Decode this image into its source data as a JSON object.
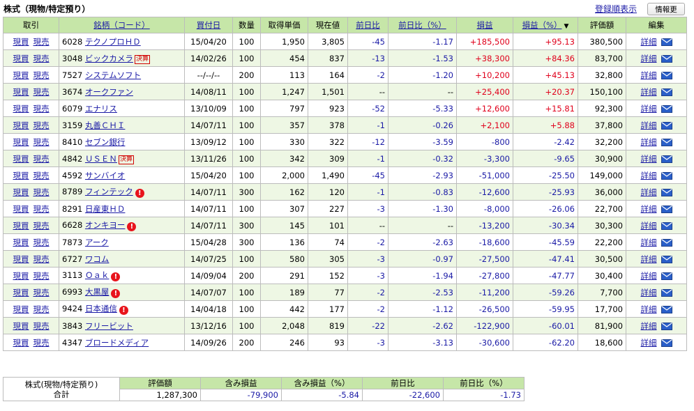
{
  "header": {
    "title": "株式（現物/特定預り）",
    "sort_link": "登録順表示",
    "refresh_button": "情報更新"
  },
  "columns": [
    "取引",
    "銘柄（コード）",
    "買付日",
    "数量",
    "取得単価",
    "現在値",
    "前日比",
    "前日比（%）",
    "損益",
    "損益（%）",
    "評価額",
    "編集"
  ],
  "sort_marker": "▼",
  "actions": {
    "buy": "現買",
    "sell": "現売",
    "detail": "詳細"
  },
  "badges": {
    "kessan": "決算"
  },
  "rows": [
    {
      "code": "6028",
      "name": "テクノプロＨＤ",
      "date": "15/04/20",
      "qty": "100",
      "cost": "1,950",
      "price": "3,805",
      "chg": "-45",
      "chg_pct": "-1.17",
      "pl": "+185,500",
      "pl_pct": "+95.13",
      "value": "380,500",
      "badge": "",
      "alert": false
    },
    {
      "code": "3048",
      "name": "ビックカメラ",
      "date": "14/02/26",
      "qty": "100",
      "cost": "454",
      "price": "837",
      "chg": "-13",
      "chg_pct": "-1.53",
      "pl": "+38,300",
      "pl_pct": "+84.36",
      "value": "83,700",
      "badge": "決算",
      "alert": false
    },
    {
      "code": "7527",
      "name": "システムソフト",
      "date": "--/--/--",
      "qty": "200",
      "cost": "113",
      "price": "164",
      "chg": "-2",
      "chg_pct": "-1.20",
      "pl": "+10,200",
      "pl_pct": "+45.13",
      "value": "32,800",
      "badge": "",
      "alert": false
    },
    {
      "code": "3674",
      "name": "オークファン",
      "date": "14/08/11",
      "qty": "100",
      "cost": "1,247",
      "price": "1,501",
      "chg": "--",
      "chg_pct": "--",
      "pl": "+25,400",
      "pl_pct": "+20.37",
      "value": "150,100",
      "badge": "",
      "alert": false
    },
    {
      "code": "6079",
      "name": "エナリス",
      "date": "13/10/09",
      "qty": "100",
      "cost": "797",
      "price": "923",
      "chg": "-52",
      "chg_pct": "-5.33",
      "pl": "+12,600",
      "pl_pct": "+15.81",
      "value": "92,300",
      "badge": "",
      "alert": false
    },
    {
      "code": "3159",
      "name": "丸善ＣＨＩ",
      "date": "14/07/11",
      "qty": "100",
      "cost": "357",
      "price": "378",
      "chg": "-1",
      "chg_pct": "-0.26",
      "pl": "+2,100",
      "pl_pct": "+5.88",
      "value": "37,800",
      "badge": "",
      "alert": false
    },
    {
      "code": "8410",
      "name": "セブン銀行",
      "date": "13/09/12",
      "qty": "100",
      "cost": "330",
      "price": "322",
      "chg": "-12",
      "chg_pct": "-3.59",
      "pl": "-800",
      "pl_pct": "-2.42",
      "value": "32,200",
      "badge": "",
      "alert": false
    },
    {
      "code": "4842",
      "name": "ＵＳＥＮ",
      "date": "13/11/26",
      "qty": "100",
      "cost": "342",
      "price": "309",
      "chg": "-1",
      "chg_pct": "-0.32",
      "pl": "-3,300",
      "pl_pct": "-9.65",
      "value": "30,900",
      "badge": "決算",
      "alert": false
    },
    {
      "code": "4592",
      "name": "サンバイオ",
      "date": "15/04/20",
      "qty": "100",
      "cost": "2,000",
      "price": "1,490",
      "chg": "-45",
      "chg_pct": "-2.93",
      "pl": "-51,000",
      "pl_pct": "-25.50",
      "value": "149,000",
      "badge": "",
      "alert": false
    },
    {
      "code": "8789",
      "name": "フィンテック",
      "date": "14/07/11",
      "qty": "300",
      "cost": "162",
      "price": "120",
      "chg": "-1",
      "chg_pct": "-0.83",
      "pl": "-12,600",
      "pl_pct": "-25.93",
      "value": "36,000",
      "badge": "",
      "alert": true
    },
    {
      "code": "8291",
      "name": "日産東ＨＤ",
      "date": "14/07/11",
      "qty": "100",
      "cost": "307",
      "price": "227",
      "chg": "-3",
      "chg_pct": "-1.30",
      "pl": "-8,000",
      "pl_pct": "-26.06",
      "value": "22,700",
      "badge": "",
      "alert": false
    },
    {
      "code": "6628",
      "name": "オンキヨー",
      "date": "14/07/11",
      "qty": "300",
      "cost": "145",
      "price": "101",
      "chg": "--",
      "chg_pct": "--",
      "pl": "-13,200",
      "pl_pct": "-30.34",
      "value": "30,300",
      "badge": "",
      "alert": true
    },
    {
      "code": "7873",
      "name": "アーク",
      "date": "15/04/28",
      "qty": "300",
      "cost": "136",
      "price": "74",
      "chg": "-2",
      "chg_pct": "-2.63",
      "pl": "-18,600",
      "pl_pct": "-45.59",
      "value": "22,200",
      "badge": "",
      "alert": false
    },
    {
      "code": "6727",
      "name": "ワコム",
      "date": "14/07/25",
      "qty": "100",
      "cost": "580",
      "price": "305",
      "chg": "-3",
      "chg_pct": "-0.97",
      "pl": "-27,500",
      "pl_pct": "-47.41",
      "value": "30,500",
      "badge": "",
      "alert": false
    },
    {
      "code": "3113",
      "name": "Ｏａｋ",
      "date": "14/09/04",
      "qty": "200",
      "cost": "291",
      "price": "152",
      "chg": "-3",
      "chg_pct": "-1.94",
      "pl": "-27,800",
      "pl_pct": "-47.77",
      "value": "30,400",
      "badge": "",
      "alert": true
    },
    {
      "code": "6993",
      "name": "大黒屋",
      "date": "14/07/07",
      "qty": "100",
      "cost": "189",
      "price": "77",
      "chg": "-2",
      "chg_pct": "-2.53",
      "pl": "-11,200",
      "pl_pct": "-59.26",
      "value": "7,700",
      "badge": "",
      "alert": true
    },
    {
      "code": "9424",
      "name": "日本通信",
      "date": "14/04/18",
      "qty": "100",
      "cost": "442",
      "price": "177",
      "chg": "-2",
      "chg_pct": "-1.12",
      "pl": "-26,500",
      "pl_pct": "-59.95",
      "value": "17,700",
      "badge": "",
      "alert": true
    },
    {
      "code": "3843",
      "name": "フリービット",
      "date": "13/12/16",
      "qty": "100",
      "cost": "2,048",
      "price": "819",
      "chg": "-22",
      "chg_pct": "-2.62",
      "pl": "-122,900",
      "pl_pct": "-60.01",
      "value": "81,900",
      "badge": "",
      "alert": false
    },
    {
      "code": "4347",
      "name": "ブロードメディア",
      "date": "14/09/26",
      "qty": "200",
      "cost": "246",
      "price": "93",
      "chg": "-3",
      "chg_pct": "-3.13",
      "pl": "-30,600",
      "pl_pct": "-62.20",
      "value": "18,600",
      "badge": "",
      "alert": false
    }
  ],
  "summary": {
    "label_line1": "株式(現物/特定預り)",
    "label_line2": "合計",
    "headers": [
      "評価額",
      "含み損益",
      "含み損益（%）",
      "前日比",
      "前日比（%）"
    ],
    "values": [
      "1,287,300",
      "-79,900",
      "-5.84",
      "-22,600",
      "-1.73"
    ]
  },
  "colors": {
    "header_bg": "#c6e6a8",
    "row_alt_bg": "#eef7e4",
    "positive": "#e0001b",
    "negative": "#1a1aa6",
    "link": "#1a1aa6"
  }
}
